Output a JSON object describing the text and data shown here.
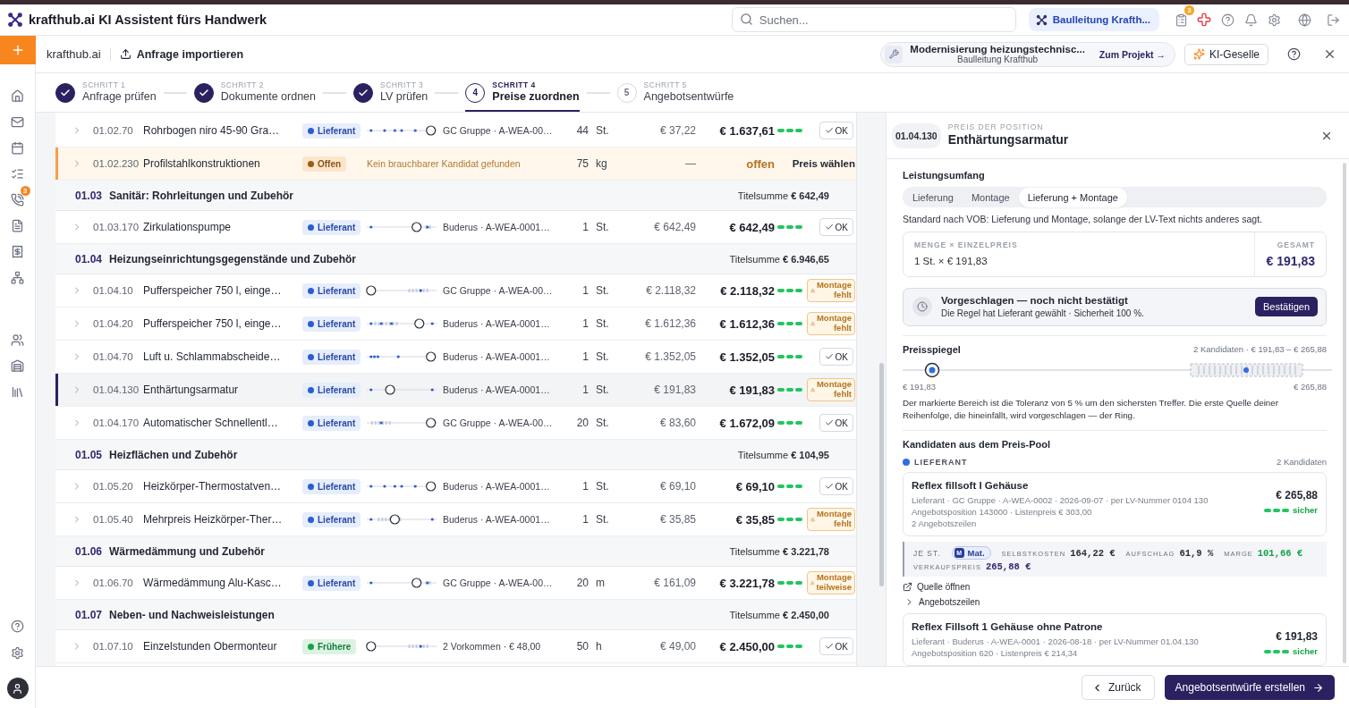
{
  "app": {
    "title": "krafthub.ai KI Assistent fürs Handwerk"
  },
  "search": {
    "placeholder": "Suchen..."
  },
  "workspace": {
    "label": "Baulleitung Krafth..."
  },
  "header": {
    "badge": "3"
  },
  "rail": {
    "badge": "3"
  },
  "breadcrumb": {
    "home": "krafthub.ai",
    "action": "Anfrage importieren"
  },
  "project": {
    "title": "Modernisierung heizungstechnisc...",
    "subtitle": "Baulleitung Krafthub",
    "link": "Zum Projekt →"
  },
  "assistant_button": "KI-Geselle",
  "steps": [
    {
      "label": "SCHRITT 1",
      "title": "Anfrage prüfen",
      "done": true,
      "selected": false
    },
    {
      "label": "SCHRITT 2",
      "title": "Dokumente ordnen",
      "done": true,
      "selected": false
    },
    {
      "label": "SCHRITT 3",
      "title": "LV prüfen",
      "done": true,
      "selected": false
    },
    {
      "label": "SCHRITT 4",
      "title": "Preise zuordnen",
      "done": false,
      "number": "4",
      "selected": true
    },
    {
      "label": "SCHRITT 5",
      "title": "Angebotsentwürfe",
      "done": false,
      "number": "5",
      "selected": false
    }
  ],
  "table": {
    "rows": [
      {
        "kind": "item",
        "selected": false,
        "code": "01.02.70",
        "name": "Rohrbogen niro 45-90 Gra…",
        "source": {
          "label": "Lieferant",
          "kind": "supplier"
        },
        "supplier": "GC Gruppe · A-WEA-00…",
        "qty": "44",
        "unit": "St.",
        "unit_price": "€ 37,22",
        "total": "€ 1.637,61",
        "status": {
          "kind": "ok",
          "label": "OK"
        }
      },
      {
        "kind": "open",
        "selected": false,
        "code": "01.02.230",
        "name": "Profilstahlkonstruktionen",
        "source": {
          "label": "Offen",
          "kind": "open"
        },
        "note": "Kein brauchbarer Kandidat gefunden",
        "qty": "75",
        "unit": "kg",
        "unit_price": "—",
        "total": "offen",
        "action": "Preis wählen"
      },
      {
        "kind": "group",
        "code": "01.03",
        "title": "Sanitär: Rohrleitungen und Zubehör",
        "sum": "Titelsumme **€ 642,49**"
      },
      {
        "kind": "item",
        "selected": false,
        "code": "01.03.170",
        "name": "Zirkulationspumpe",
        "source": {
          "label": "Lieferant",
          "kind": "supplier"
        },
        "supplier": "Buderus · A-WEA-0001…",
        "qty": "1",
        "unit": "St.",
        "unit_price": "€ 642,49",
        "total": "€ 642,49",
        "status": {
          "kind": "ok",
          "label": "OK"
        }
      },
      {
        "kind": "group",
        "code": "01.04",
        "title": "Heizungseinrichtungsgegenstände und Zubehör",
        "sum": "Titelsumme **€ 6.946,65**"
      },
      {
        "kind": "item",
        "selected": false,
        "code": "01.04.10",
        "name": "Pufferspeicher 750 l, einge…",
        "source": {
          "label": "Lieferant",
          "kind": "supplier"
        },
        "supplier": "GC Gruppe · A-WEA-00…",
        "qty": "1",
        "unit": "St.",
        "unit_price": "€ 2.118,32",
        "total": "€ 2.118,32",
        "status": {
          "kind": "warning",
          "label": "Montage fehlt"
        }
      },
      {
        "kind": "item",
        "selected": false,
        "code": "01.04.20",
        "name": "Pufferspeicher 750 l, einge…",
        "source": {
          "label": "Lieferant",
          "kind": "supplier"
        },
        "supplier": "Buderus · A-WEA-0001…",
        "qty": "1",
        "unit": "St.",
        "unit_price": "€ 1.612,36",
        "total": "€ 1.612,36",
        "status": {
          "kind": "warning",
          "label": "Montage fehlt"
        }
      },
      {
        "kind": "item",
        "selected": false,
        "code": "01.04.70",
        "name": "Luft u. Schlammabscheide…",
        "source": {
          "label": "Lieferant",
          "kind": "supplier"
        },
        "supplier": "Buderus · A-WEA-0001…",
        "qty": "1",
        "unit": "St.",
        "unit_price": "€ 1.352,05",
        "total": "€ 1.352,05",
        "status": {
          "kind": "ok",
          "label": "OK"
        }
      },
      {
        "kind": "item",
        "selected": true,
        "code": "01.04.130",
        "name": "Enthärtungsarmatur",
        "source": {
          "label": "Lieferant",
          "kind": "supplier"
        },
        "supplier": "Buderus · A-WEA-0001…",
        "qty": "1",
        "unit": "St.",
        "unit_price": "€ 191,83",
        "total": "€ 191,83",
        "status": {
          "kind": "warning",
          "label": "Montage fehlt"
        }
      },
      {
        "kind": "item",
        "selected": false,
        "code": "01.04.170",
        "name": "Automatischer Schnellentl…",
        "source": {
          "label": "Lieferant",
          "kind": "supplier"
        },
        "supplier": "GC Gruppe · A-WEA-00…",
        "qty": "20",
        "unit": "St.",
        "unit_price": "€ 83,60",
        "total": "€ 1.672,09",
        "status": {
          "kind": "ok",
          "label": "OK"
        }
      },
      {
        "kind": "group",
        "code": "01.05",
        "title": "Heizflächen und Zubehör",
        "sum": "Titelsumme **€ 104,95**"
      },
      {
        "kind": "item",
        "selected": false,
        "code": "01.05.20",
        "name": "Heizkörper-Thermostatven…",
        "source": {
          "label": "Lieferant",
          "kind": "supplier"
        },
        "supplier": "Buderus · A-WEA-0001…",
        "qty": "1",
        "unit": "St.",
        "unit_price": "€ 69,10",
        "total": "€ 69,10",
        "status": {
          "kind": "ok",
          "label": "OK"
        }
      },
      {
        "kind": "item",
        "selected": false,
        "code": "01.05.40",
        "name": "Mehrpreis Heizkörper-Ther…",
        "source": {
          "label": "Lieferant",
          "kind": "supplier"
        },
        "supplier": "Buderus · A-WEA-0001…",
        "qty": "1",
        "unit": "St.",
        "unit_price": "€ 35,85",
        "total": "€ 35,85",
        "status": {
          "kind": "warning",
          "label": "Montage fehlt"
        }
      },
      {
        "kind": "group",
        "code": "01.06",
        "title": "Wärmedämmung und Zubehör",
        "sum": "Titelsumme **€ 3.221,78**"
      },
      {
        "kind": "item",
        "selected": false,
        "code": "01.06.70",
        "name": "Wärmedämmung Alu-Kasc…",
        "source": {
          "label": "Lieferant",
          "kind": "supplier"
        },
        "supplier": "GC Gruppe · A-WEA-00…",
        "qty": "20",
        "unit": "m",
        "unit_price": "€ 161,09",
        "total": "€ 3.221,78",
        "status": {
          "kind": "warning",
          "label": "Montage teilweise"
        }
      },
      {
        "kind": "group",
        "code": "01.07",
        "title": "Neben- und Nachweisleistungen",
        "sum": "Titelsumme **€ 2.450,00**"
      },
      {
        "kind": "item",
        "selected": false,
        "code": "01.07.10",
        "name": "Einzelstunden Obermonteur",
        "source": {
          "label": "Frühere",
          "kind": "history"
        },
        "supplier": "2 Vorkommen · € 48,00",
        "qty": "50",
        "unit": "h",
        "unit_price": "€ 49,00",
        "total": "€ 2.450,00",
        "status": {
          "kind": "ok",
          "label": "OK"
        }
      }
    ]
  },
  "detail": {
    "code": "01.04.130",
    "eyebrow": "PREIS DER POSITION",
    "title": "Enthärtungsarmatur",
    "scope": {
      "label": "Leistungsumfang",
      "options": [
        {
          "label": "Lieferung",
          "selected": false
        },
        {
          "label": "Montage",
          "selected": false
        },
        {
          "label": "Lieferung + Montage",
          "selected": true
        }
      ],
      "note": "Standard nach VOB: Lieferung und Montage, solange der LV-Text nichts anderes sagt."
    },
    "calc": {
      "label": "MENGE × EINZELPREIS",
      "value": "1 St. × € 191,83",
      "total_label": "GESAMT",
      "total": "€ 191,83"
    },
    "suggestion": {
      "title": "Vorgeschlagen — noch nicht bestätigt",
      "text": "Die Regel hat Lieferant gewählt · Sicherheit 100 %.",
      "button": "Bestätigen"
    },
    "price_mirror": {
      "title": "Preisspiegel",
      "summary": "2 Kandidaten · € 191,83 – € 265,88",
      "min": "€ 191,83",
      "max": "€ 265,88",
      "note": "Der markierte Bereich ist die Toleranz von 5 % um den sichersten Treffer. Die erste Quelle deiner Reihenfolge, die hineinfällt, wird vorgeschlagen — der Ring."
    },
    "candidates": {
      "title": "Kandidaten aus dem Preis-Pool",
      "group": "LIEFERANT",
      "count": "2 Kandidaten",
      "items": [
        {
          "title": "Reflex fillsoft I Gehäuse",
          "meta": [
            "Lieferant · GC Gruppe · A-WEA-0002 · 2026-09-07 · per LV-Nummer 0104 130",
            "Angebotsposition 143000 · Listenpreis € 303,00",
            "2 Angebotszeilen"
          ],
          "price": "€ 265,88",
          "confidence": "sicher",
          "breakdown": {
            "per": "JE ST.",
            "chip_key": "M",
            "chip": "Mat.",
            "figures": [
              {
                "label": "SELBSTKOSTEN",
                "value": "164,22 €",
                "kind": "plain"
              },
              {
                "label": "AUFSCHLAG",
                "value": "61,9 %",
                "kind": "plain"
              },
              {
                "label": "MARGE",
                "value": "101,66 €",
                "kind": "positive"
              },
              {
                "label": "VERKAUFSPREIS",
                "value": "265,88 €",
                "kind": "price"
              }
            ]
          },
          "source_link": "Quelle öffnen",
          "lines_toggle": {
            "label": "Angebotszeilen",
            "expanded": false
          }
        },
        {
          "title": "Reflex Fillsoft 1 Gehäuse ohne Patrone",
          "meta": [
            "Lieferant · Buderus · A-WEA-0001 · 2026-08-18 · per LV-Nummer 01.04.130",
            "Angebotsposition 620 · Listenpreis € 214,34"
          ],
          "price": "€ 191,83",
          "confidence": "sicher"
        }
      ]
    }
  },
  "footer": {
    "back": "Zurück",
    "next": "Angebotsentwürfe erstellen"
  }
}
